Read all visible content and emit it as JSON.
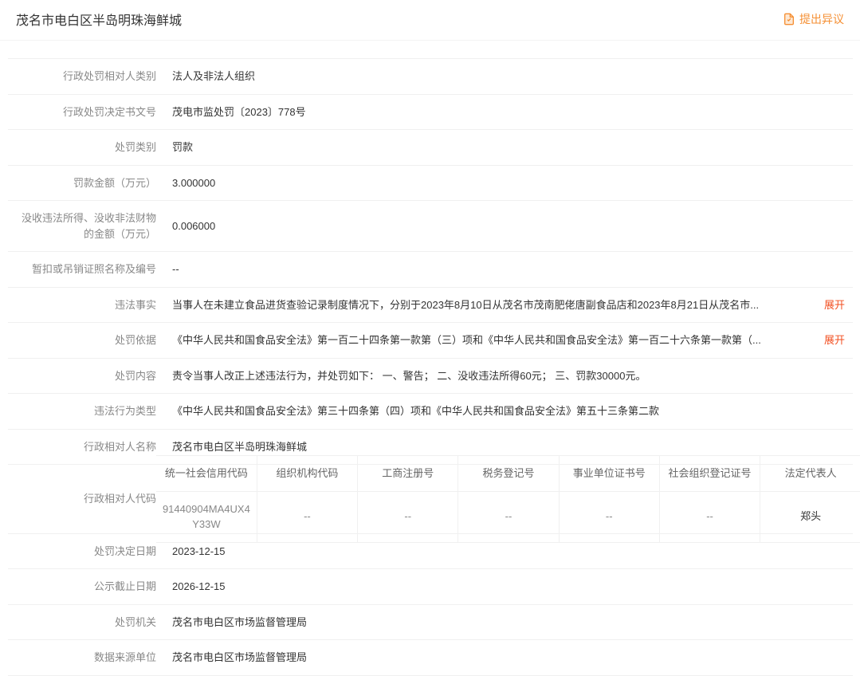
{
  "header": {
    "title": "茂名市电白区半岛明珠海鲜城",
    "objection": "提出异议"
  },
  "expand_label": "展开",
  "rows": {
    "party_type_label": "行政处罚相对人类别",
    "party_type_value": "法人及非法人组织",
    "doc_no_label": "行政处罚决定书文号",
    "doc_no_value": "茂电市监处罚〔2023〕778号",
    "penalty_type_label": "处罚类别",
    "penalty_type_value": "罚款",
    "fine_amount_label": "罚款金额（万元）",
    "fine_amount_value": "3.000000",
    "confiscate_label": "没收违法所得、没收非法财物的金额（万元）",
    "confiscate_value": "0.006000",
    "suspend_label": "暂扣或吊销证照名称及编号",
    "suspend_value": "--",
    "illegal_fact_label": "违法事实",
    "illegal_fact_value": "当事人在未建立食品进货查验记录制度情况下，分别于2023年8月10日从茂名市茂南肥佬唐副食品店和2023年8月21日从茂名市...",
    "basis_label": "处罚依据",
    "basis_value": "《中华人民共和国食品安全法》第一百二十四条第一款第（三）项和《中华人民共和国食品安全法》第一百二十六条第一款第（...",
    "content_label": "处罚内容",
    "content_value": "责令当事人改正上述违法行为，并处罚如下： 一、警告； 二、没收违法所得60元； 三、罚款30000元。",
    "illegal_type_label": "违法行为类型",
    "illegal_type_value": "《中华人民共和国食品安全法》第三十四条第（四）项和《中华人民共和国食品安全法》第五十三条第二款",
    "party_name_label": "行政相对人名称",
    "party_name_value": "茂名市电白区半岛明珠海鲜城",
    "party_code_label": "行政相对人代码",
    "decision_date_label": "处罚决定日期",
    "decision_date_value": "2023-12-15",
    "publicity_end_label": "公示截止日期",
    "publicity_end_value": "2026-12-15",
    "authority_label": "处罚机关",
    "authority_value": "茂名市电白区市场监督管理局",
    "source_label": "数据来源单位",
    "source_value": "茂名市电白区市场监督管理局"
  },
  "code_table": {
    "headers": {
      "uscc": "统一社会信用代码",
      "org": "组织机构代码",
      "biz": "工商注册号",
      "tax": "税务登记号",
      "inst": "事业单位证书号",
      "social": "社会组织登记证号",
      "rep": "法定代表人"
    },
    "values": {
      "uscc": "91440904MA4UX4Y33W",
      "org": "--",
      "biz": "--",
      "tax": "--",
      "inst": "--",
      "social": "--",
      "rep": "郑头"
    }
  }
}
